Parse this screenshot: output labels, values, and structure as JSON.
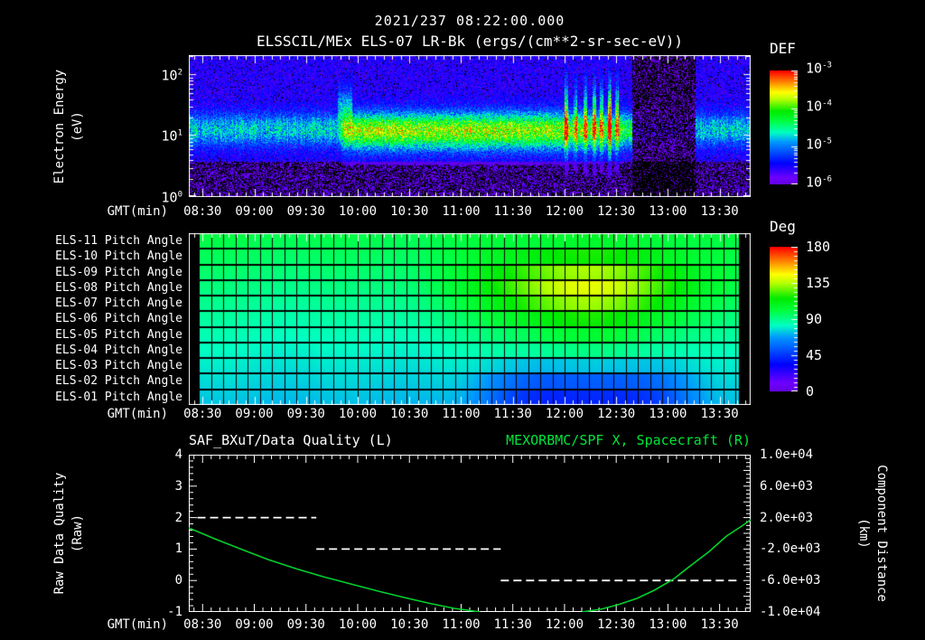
{
  "header": {
    "datetime": "2021/237 08:22:00.000",
    "title": "ELSSCIL/MEx ELS-07 LR-Bk  (ergs/(cm**2-sr-sec-eV))"
  },
  "colors": {
    "background": "#000000",
    "text": "#ffffff",
    "accent_green": "#00e53c",
    "curve_green": "#00d22d",
    "colormap": "rainbow"
  },
  "time_axis": {
    "label": "GMT(min)",
    "ticks": [
      "08:30",
      "09:00",
      "09:30",
      "10:00",
      "10:30",
      "11:00",
      "11:30",
      "12:00",
      "12:30",
      "13:00",
      "13:30"
    ],
    "range": [
      "08:22",
      "13:48"
    ]
  },
  "spectrogram": {
    "ylabel_lines": [
      "Electron Energy",
      "(eV)"
    ],
    "y_tick_exponents": [
      2,
      1,
      0
    ]
  },
  "def_colorbar": {
    "title": "DEF",
    "tick_exponents": [
      -3,
      -4,
      -5,
      -6
    ]
  },
  "pitch_panel": {
    "row_labels": [
      "ELS-11 Pitch Angle",
      "ELS-10 Pitch Angle",
      "ELS-09 Pitch Angle",
      "ELS-08 Pitch Angle",
      "ELS-07 Pitch Angle",
      "ELS-06 Pitch Angle",
      "ELS-05 Pitch Angle",
      "ELS-04 Pitch Angle",
      "ELS-03 Pitch Angle",
      "ELS-02 Pitch Angle",
      "ELS-01 Pitch Angle"
    ]
  },
  "deg_colorbar": {
    "title": "Deg",
    "ticks": [
      180,
      135,
      90,
      45,
      0
    ]
  },
  "bottom": {
    "title_left": "SAF_BXuT/Data Quality (L)",
    "title_right": "MEXORBMC/SPF X, Spacecraft (R)",
    "left_label_lines": [
      "Raw Data Quality",
      "(Raw)"
    ],
    "right_label_lines": [
      "Component Distance",
      "(km)"
    ],
    "left_ticks": [
      4,
      3,
      2,
      1,
      0,
      -1
    ],
    "right_ticks": [
      "1.0e+04",
      "6.0e+03",
      "2.0e+03",
      "-2.0e+03",
      "-6.0e+03",
      "-1.0e+04"
    ]
  },
  "chart_data": [
    {
      "type": "heatmap",
      "name": "electron-energy-spectrogram",
      "title": "ELSSCIL/MEx ELS-07 LR-Bk",
      "units": "ergs/(cm**2-sr-sec-eV)",
      "x_axis": {
        "label": "GMT(min)",
        "range": [
          "08:22",
          "13:48"
        ],
        "ticks": [
          "08:30",
          "09:00",
          "09:30",
          "10:00",
          "10:30",
          "11:00",
          "11:30",
          "12:00",
          "12:30",
          "13:00",
          "13:30"
        ]
      },
      "y_axis": {
        "label": "Electron Energy (eV)",
        "scale": "log",
        "range_ev": [
          1,
          210
        ],
        "tick_exponents": [
          2,
          1,
          0
        ]
      },
      "colorbar": {
        "title": "DEF",
        "scale": "log",
        "range": [
          1e-06,
          0.001
        ],
        "tick_exponents": [
          -3,
          -4,
          -5,
          -6
        ],
        "colormap": "rainbow"
      },
      "features": {
        "persistent_band": {
          "energy_ev": [
            6,
            25
          ],
          "flux_level": "~1e-5 (cyan)",
          "span": [
            "08:22",
            "13:48"
          ]
        },
        "green_enhancement": {
          "energy_ev": [
            8,
            35
          ],
          "flux_level": "~1e-4 (green)",
          "span": [
            "09:48",
            "12:39"
          ],
          "strongest": [
            "09:50",
            "11:52"
          ]
        },
        "vertical_spikes": {
          "span": [
            "12:01",
            "12:33"
          ],
          "top_energy_ev": 60
        },
        "data_dropout": {
          "span": [
            "12:39",
            "13:16"
          ]
        },
        "band_resumes": {
          "span": [
            "13:16",
            "13:48"
          ]
        },
        "background": "blue noise above band, sparse purple/black speckle below ~4 eV"
      }
    },
    {
      "type": "heatmap",
      "name": "pitch-angle-panel",
      "rows_top_to_bottom": [
        "ELS-11 Pitch Angle",
        "ELS-10 Pitch Angle",
        "ELS-09 Pitch Angle",
        "ELS-08 Pitch Angle",
        "ELS-07 Pitch Angle",
        "ELS-06 Pitch Angle",
        "ELS-05 Pitch Angle",
        "ELS-04 Pitch Angle",
        "ELS-03 Pitch Angle",
        "ELS-02 Pitch Angle",
        "ELS-01 Pitch Angle"
      ],
      "colorbar": {
        "title": "Deg",
        "range": [
          0,
          180
        ],
        "ticks": [
          180,
          135,
          90,
          45,
          0
        ],
        "colormap": "rainbow"
      },
      "data_span": [
        "08:28",
        "13:41"
      ],
      "base_deg_top_to_bottom": [
        102,
        100,
        98,
        96,
        93,
        90,
        87,
        84,
        81,
        79,
        77
      ],
      "yellow_enhancement": {
        "rows": [
          "ELS-10",
          "ELS-09",
          "ELS-08",
          "ELS-07",
          "ELS-06"
        ],
        "peak_deg": 144,
        "center": "12:12",
        "span": [
          "11:15",
          "13:10"
        ]
      },
      "blue_depression": {
        "rows": [
          "ELS-02",
          "ELS-01"
        ],
        "min_deg": 47,
        "center": "12:13",
        "span": [
          "11:16",
          "13:10"
        ]
      }
    },
    {
      "type": "line",
      "name": "quality-and-distance",
      "title_left": "SAF_BXuT/Data Quality (L)",
      "title_right": "MEXORBMC/SPF X, Spacecraft (R)",
      "left_axis": {
        "label": "Raw Data Quality (Raw)",
        "range": [
          -1,
          4
        ],
        "ticks": [
          4,
          3,
          2,
          1,
          0,
          -1
        ]
      },
      "right_axis": {
        "label": "Component Distance (km)",
        "range": [
          -10000,
          10000
        ],
        "ticks": [
          "1.0e+04",
          "6.0e+03",
          "2.0e+03",
          "-2.0e+03",
          "-6.0e+03",
          "-1.0e+04"
        ]
      },
      "series": [
        {
          "name": "SAF_BXuT/Data Quality",
          "axis": "left",
          "style": "dashed-white",
          "steps": [
            {
              "from": "08:27",
              "to": "09:36",
              "value": 2
            },
            {
              "from": "09:36",
              "to": "11:23",
              "value": 1
            },
            {
              "from": "11:23",
              "to": "13:41",
              "value": 0
            }
          ]
        },
        {
          "name": "MEXORBMC/SPF X, Spacecraft",
          "axis": "right",
          "style": "solid-green",
          "note": "curve dips below -1.0e+04 km (off scale) between 11:11 and 12:10",
          "segments": [
            [
              [
                "08:22",
                690
              ],
              [
                "08:37",
                -690
              ],
              [
                "08:53",
                -2070
              ],
              [
                "09:08",
                -3330
              ],
              [
                "09:24",
                -4480
              ],
              [
                "09:40",
                -5520
              ],
              [
                "09:56",
                -6440
              ],
              [
                "10:12",
                -7360
              ],
              [
                "10:27",
                -8160
              ],
              [
                "10:43",
                -8970
              ],
              [
                "10:56",
                -9540
              ],
              [
                "11:11",
                -10000
              ]
            ],
            [
              [
                "12:10",
                -10000
              ],
              [
                "12:21",
                -9660
              ],
              [
                "12:31",
                -9080
              ],
              [
                "12:42",
                -8280
              ],
              [
                "12:52",
                -7240
              ],
              [
                "13:03",
                -5860
              ],
              [
                "13:13",
                -4140
              ],
              [
                "13:24",
                -2300
              ],
              [
                "13:34",
                -350
              ],
              [
                "13:42",
                800
              ],
              [
                "13:48",
                1720
              ]
            ]
          ]
        }
      ]
    }
  ]
}
